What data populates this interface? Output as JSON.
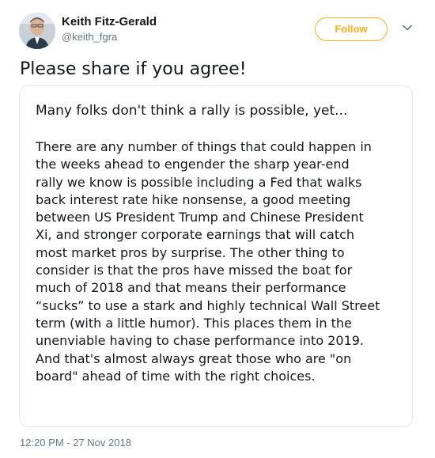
{
  "author": {
    "display_name": "Keith Fitz-Gerald",
    "handle": "@keith_fgra"
  },
  "follow_button": {
    "label": "Follow",
    "color": "#ffad1f"
  },
  "menu": {
    "icon": "chevron-down-icon"
  },
  "tweet": {
    "text": "Please share if you agree!",
    "timestamp": "12:20 PM - 27 Nov 2018"
  },
  "image_card": {
    "heading": "Many folks don't think a rally is possible, yet...",
    "lines": [
      "There are any number of things that could happen in",
      "the weeks ahead to engender the sharp year-end",
      "rally we know is possible including a Fed that walks",
      "back interest rate hike nonsense, a good meeting",
      "between US President Trump and Chinese President",
      "Xi, and stronger corporate earnings that will catch",
      "most market pros by surprise. The other thing to",
      "consider is that the pros have missed the boat for",
      "much of 2018 and that means their performance",
      "“sucks” to use a stark and highly technical Wall Street",
      "term (with a little humor). This places them in the",
      "unenviable having to chase performance into 2019.",
      "And that's almost always great those who are \"on",
      "board\" ahead of time with the right choices."
    ]
  }
}
